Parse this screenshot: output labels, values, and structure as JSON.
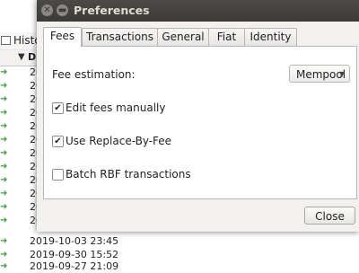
{
  "background": {
    "tab_label": "Histor",
    "column_header": "D",
    "visible_dates": [
      "2019-10-03 23:45",
      "2019-09-30 15:52",
      "2019-09-27 21:09"
    ],
    "partial_row_prefix": "20"
  },
  "dialog": {
    "title": "Preferences",
    "tabs": [
      {
        "label": "Fees",
        "active": true
      },
      {
        "label": "Transactions",
        "active": false
      },
      {
        "label": "General",
        "active": false
      },
      {
        "label": "Fiat",
        "active": false
      },
      {
        "label": "Identity",
        "active": false
      }
    ],
    "fee_estimation": {
      "label": "Fee estimation:",
      "selected": "Mempool"
    },
    "options": [
      {
        "label": "Edit fees manually",
        "checked": true
      },
      {
        "label": "Use Replace-By-Fee",
        "checked": true
      },
      {
        "label": "Batch RBF transactions",
        "checked": false
      }
    ],
    "close_label": "Close"
  },
  "colors": {
    "titlebar": "#3c3b37",
    "dialog_bg": "#f2f1f0",
    "receive_arrow": "#3aa33a"
  }
}
